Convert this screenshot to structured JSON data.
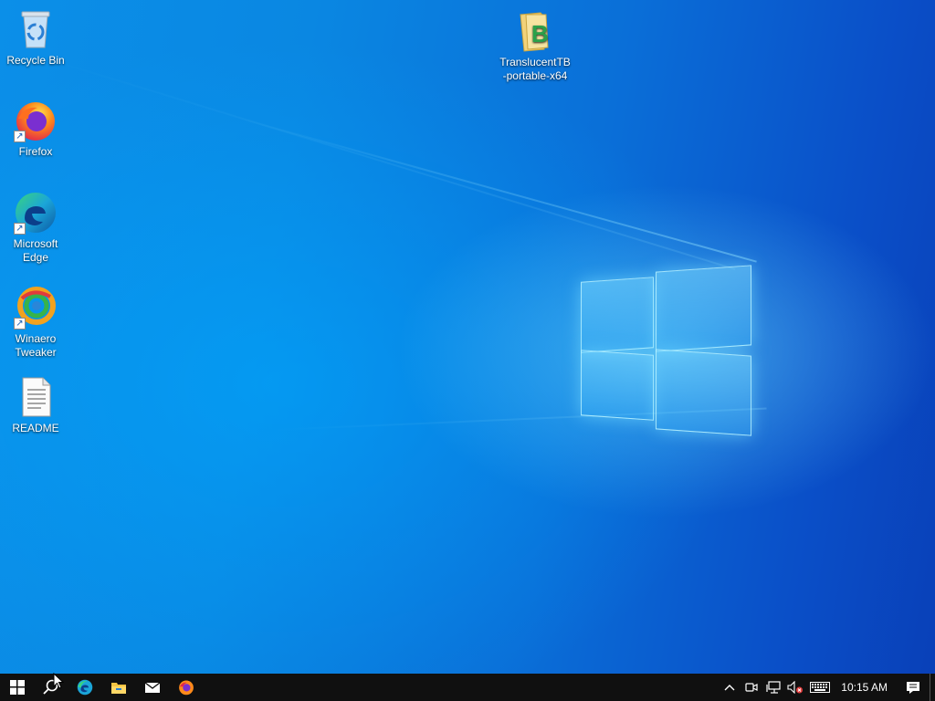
{
  "desktop": {
    "icons": [
      {
        "label": "Recycle Bin",
        "icon": "recycle-bin-icon"
      },
      {
        "label": "Firefox",
        "icon": "firefox-icon"
      },
      {
        "label": "Microsoft\nEdge",
        "icon": "edge-icon"
      },
      {
        "label": "Winaero\nTweaker",
        "icon": "winaero-tweaker-icon"
      },
      {
        "label": "README",
        "icon": "text-file-icon"
      },
      {
        "label": "TranslucentTB\n-portable-x64",
        "icon": "zip-folder-icon"
      }
    ]
  },
  "taskbar": {
    "apps": [
      "start-icon",
      "search-icon",
      "edge-icon",
      "file-explorer-icon",
      "mail-icon",
      "firefox-icon"
    ],
    "tray": [
      "chevron-up-icon",
      "meet-now-icon",
      "network-icon",
      "volume-muted-icon",
      "keyboard-icon"
    ],
    "clock": "10:15 AM",
    "notifications_icon": "action-center-icon"
  },
  "colors": {
    "taskbar": "#101010",
    "wallpaper_blue": "#0a6fd8",
    "highlight": "#78d7ff"
  }
}
